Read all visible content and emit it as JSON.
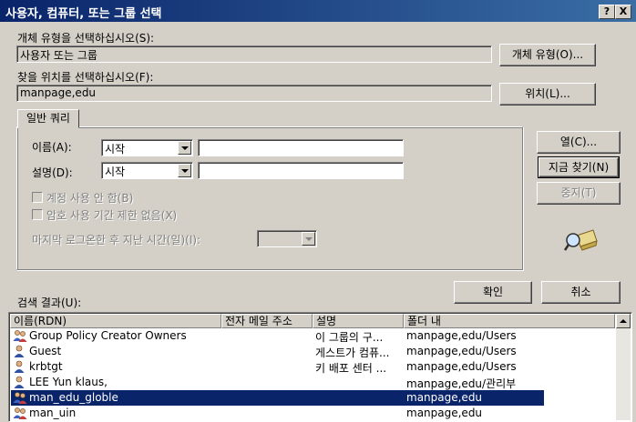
{
  "window": {
    "title": "사용자, 컴퓨터, 또는 그룹 선택"
  },
  "titlebar": {
    "help_label": "?",
    "close_label": "X"
  },
  "object_type": {
    "label": "개체 유형을 선택하십시오(S):",
    "value": "사용자 또는 그룹",
    "button": "개체 유형(O)..."
  },
  "location": {
    "label": "찾을 위치를 선택하십시오(F):",
    "value": "manpage,edu",
    "button": "위치(L)..."
  },
  "query": {
    "tab_label": "일반 쿼리",
    "name_label": "이름(A):",
    "name_mode": "시작",
    "name_value": "",
    "desc_label": "설명(D):",
    "desc_mode": "시작",
    "desc_value": "",
    "disabled_accounts": "계정 사용 안 함(B)",
    "non_expiring": "암호 사용 기간 제한 없음(X)",
    "last_logon_label": "마지막 로그온한 후 지난 시간(일)(I):",
    "last_logon_value": ""
  },
  "buttons": {
    "columns": "열(C)...",
    "find_now": "지금 찾기(N)",
    "stop": "중지(T)",
    "ok": "확인",
    "cancel": "취소"
  },
  "results": {
    "label": "검색 결과(U):",
    "columns": [
      "이름(RDN)",
      "전자 메일 주소",
      "설명",
      "폴더 내"
    ],
    "rows": [
      {
        "name": "Group Policy Creator Owners",
        "email": "",
        "desc": "이 그룹의 구...",
        "folder": "manpage,edu/Users",
        "icon": "group-icon"
      },
      {
        "name": "Guest",
        "email": "",
        "desc": "게스트가 컴퓨...",
        "folder": "manpage,edu/Users",
        "icon": "user-icon"
      },
      {
        "name": "krbtgt",
        "email": "",
        "desc": "키 배포 센터 ...",
        "folder": "manpage,edu/Users",
        "icon": "user-icon"
      },
      {
        "name": "LEE Yun klaus,",
        "email": "",
        "desc": "",
        "folder": "manpage,edu/관리부",
        "icon": "user-icon"
      },
      {
        "name": "man_edu_globle",
        "email": "",
        "desc": "",
        "folder": "manpage,edu",
        "icon": "group-icon"
      },
      {
        "name": "man_uin",
        "email": "",
        "desc": "",
        "folder": "manpage,edu",
        "icon": "group-icon"
      }
    ]
  }
}
